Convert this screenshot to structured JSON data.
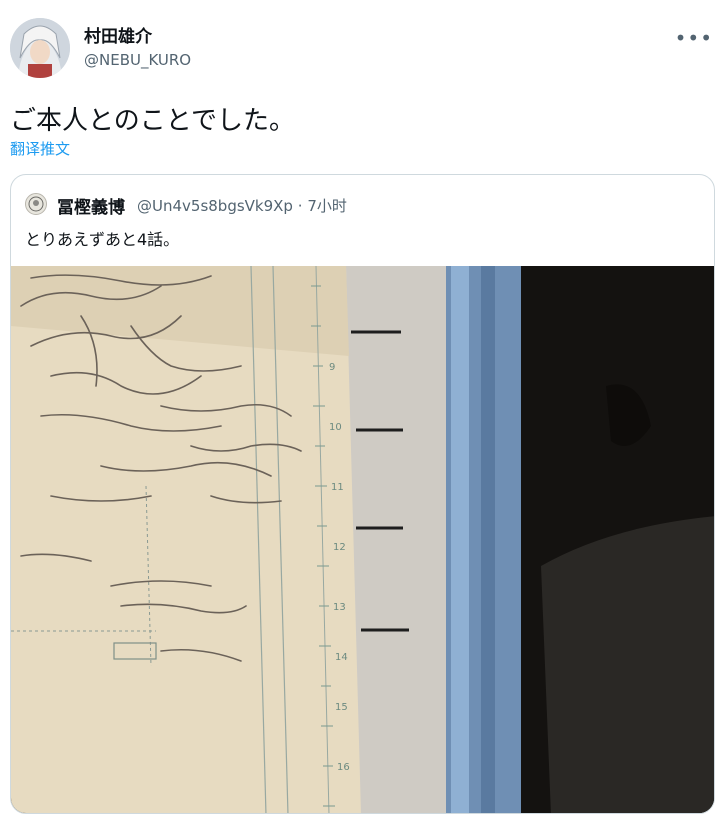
{
  "author": {
    "name": "村田雄介",
    "handle": "@NEBU_KURO",
    "avatar_icon": "user-avatar"
  },
  "more_icon": "more-icon",
  "tweet": {
    "text": "ご本人とのことでした。",
    "translate_label": "翻译推文"
  },
  "quoted_tweet": {
    "name": "冨樫義博",
    "handle": "@Un4v5s8bgsVk9Xp",
    "separator": "·",
    "time": "7小时",
    "text": "とりあえずあと4話。",
    "image_icon": "manuscript-photo",
    "ruler_ticks": [
      "9",
      "10",
      "11",
      "12",
      "13",
      "14",
      "15",
      "16"
    ]
  },
  "colors": {
    "link": "#1d9bf0",
    "secondary_text": "#536471",
    "border": "#cfd9de"
  }
}
